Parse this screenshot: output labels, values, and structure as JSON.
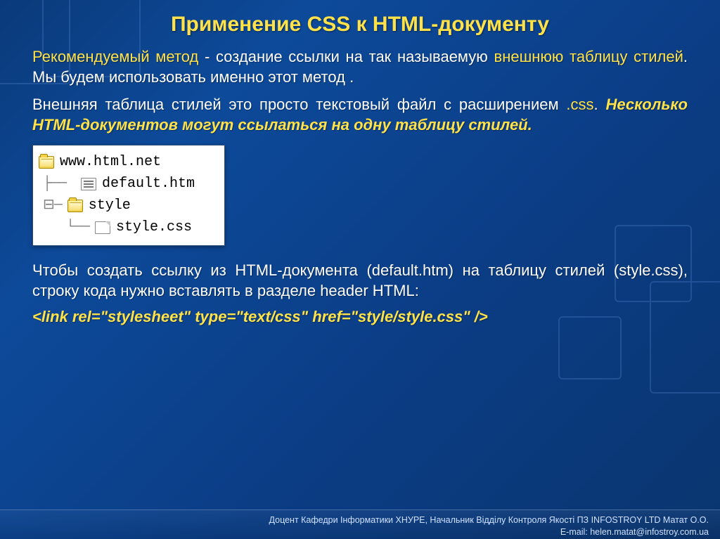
{
  "title": "Применение CSS к HTML-документу",
  "p1": {
    "lead": "Рекомендуемый метод",
    "rest1": " - создание ссылки на так называемую ",
    "highlight": "внешнюю таблицу стилей",
    "rest2": ". Мы будем использовать именно этот метод ."
  },
  "p2": {
    "part1": "Внешняя таблица стилей это просто текстовый файл с расширением ",
    "ext": ".css",
    "part2": ". ",
    "em": "Несколько HTML-документов могут ссылаться на одну таблицу стилей."
  },
  "tree": {
    "root": "www.html.net",
    "file_htm": "default.htm",
    "folder_style": "style",
    "file_css": "style.css"
  },
  "p3": "Чтобы создать ссылку из HTML-документа (default.htm) на таблицу стилей (style.css), строку кода нужно вставлять в разделе header HTML:",
  "code_line": "<link rel=\"stylesheet\" type=\"text/css\" href=\"style/style.css\" />",
  "footer": {
    "line1": "Доцент Кафедри Інформатики ХНУРЕ, Начальник Відділу Контроля Якості ПЗ INFOSTROY LTD Матат О.О.",
    "line2": "E-mail: helen.matat@infostroy.com.ua"
  }
}
